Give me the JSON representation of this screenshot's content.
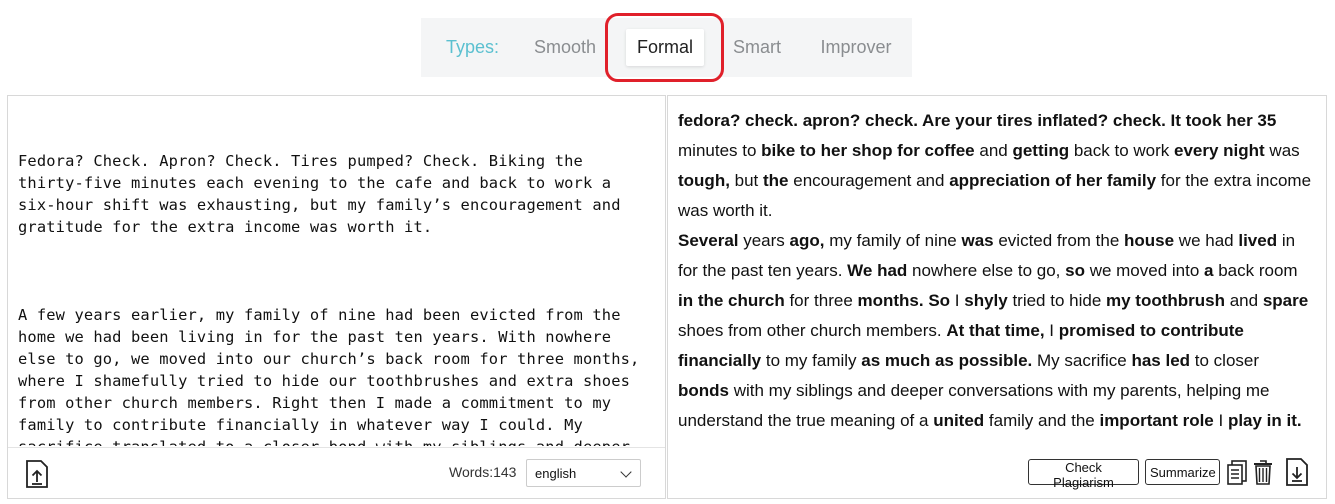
{
  "tabs": {
    "label": "Types:",
    "items": [
      "Smooth",
      "Formal",
      "Smart",
      "Improver"
    ],
    "active": "Formal"
  },
  "input": {
    "paragraph1": "Fedora? Check. Apron? Check. Tires pumped? Check. Biking the thirty-five minutes each evening to the cafe and back to work a six-hour shift was exhausting, but my family’s encouragement and gratitude for the extra income was worth it.",
    "paragraph2": "A few years earlier, my family of nine had been evicted from the home we had been living in for the past ten years. With nowhere else to go, we moved into our church’s back room for three months, where I shamefully tried to hide our toothbrushes and extra shoes from other church members. Right then I made a commitment to my family to contribute financially in whatever way I could. My sacrifice translated to a closer bond with my siblings and deeper conversations with my parents, helping me understand the true meaning of a unified family and the valuable part I play in that."
  },
  "footer_left": {
    "words_label": "Words:",
    "words_count": "143",
    "language": "english"
  },
  "output": {
    "segments": [
      [
        "fedora? check. apron? check. Are your tires inflated? check. It took her 35",
        true
      ],
      [
        " minutes to ",
        false
      ],
      [
        "bike to her shop for coffee",
        true
      ],
      [
        " and ",
        false
      ],
      [
        "getting",
        true
      ],
      [
        " back to work ",
        false
      ],
      [
        "every night",
        true
      ],
      [
        " was ",
        false
      ],
      [
        "tough,",
        true
      ],
      [
        " but ",
        false
      ],
      [
        "the",
        true
      ],
      [
        " encouragement and ",
        false
      ],
      [
        "appreciation of her family",
        true
      ],
      [
        " for the extra income was worth it.",
        false
      ],
      [
        "\n ",
        false
      ],
      [
        "Several",
        true
      ],
      [
        " years ",
        false
      ],
      [
        "ago,",
        true
      ],
      [
        " my family of nine ",
        false
      ],
      [
        "was",
        true
      ],
      [
        " evicted from the ",
        false
      ],
      [
        "house",
        true
      ],
      [
        " we had ",
        false
      ],
      [
        "lived",
        true
      ],
      [
        " in for the past ten years. ",
        false
      ],
      [
        "We had",
        true
      ],
      [
        " nowhere else to go, ",
        false
      ],
      [
        "so",
        true
      ],
      [
        " we moved into ",
        false
      ],
      [
        "a",
        true
      ],
      [
        " back room ",
        false
      ],
      [
        "in the church",
        true
      ],
      [
        " for three ",
        false
      ],
      [
        "months. So",
        true
      ],
      [
        " I ",
        false
      ],
      [
        "shyly",
        true
      ],
      [
        " tried to hide ",
        false
      ],
      [
        "my toothbrush",
        true
      ],
      [
        " and ",
        false
      ],
      [
        "spare",
        true
      ],
      [
        " shoes from other church members. ",
        false
      ],
      [
        "At that time,",
        true
      ],
      [
        " I ",
        false
      ],
      [
        "promised to contribute financially",
        true
      ],
      [
        " to my family ",
        false
      ],
      [
        "as much as possible.",
        true
      ],
      [
        " My sacrifice ",
        false
      ],
      [
        "has led",
        true
      ],
      [
        " to closer ",
        false
      ],
      [
        "bonds",
        true
      ],
      [
        " with my siblings and deeper conversations with my parents, helping me understand the true meaning of a ",
        false
      ],
      [
        "united",
        true
      ],
      [
        " family and the ",
        false
      ],
      [
        "important role",
        true
      ],
      [
        " I ",
        false
      ],
      [
        "play in it.",
        true
      ]
    ]
  },
  "actions": {
    "check_plagiarism": "Check Plagiarism",
    "summarize": "Summarize"
  },
  "icons": {
    "upload": "upload-icon",
    "copy": "copy-icon",
    "delete": "trash-icon",
    "download": "download-icon"
  }
}
